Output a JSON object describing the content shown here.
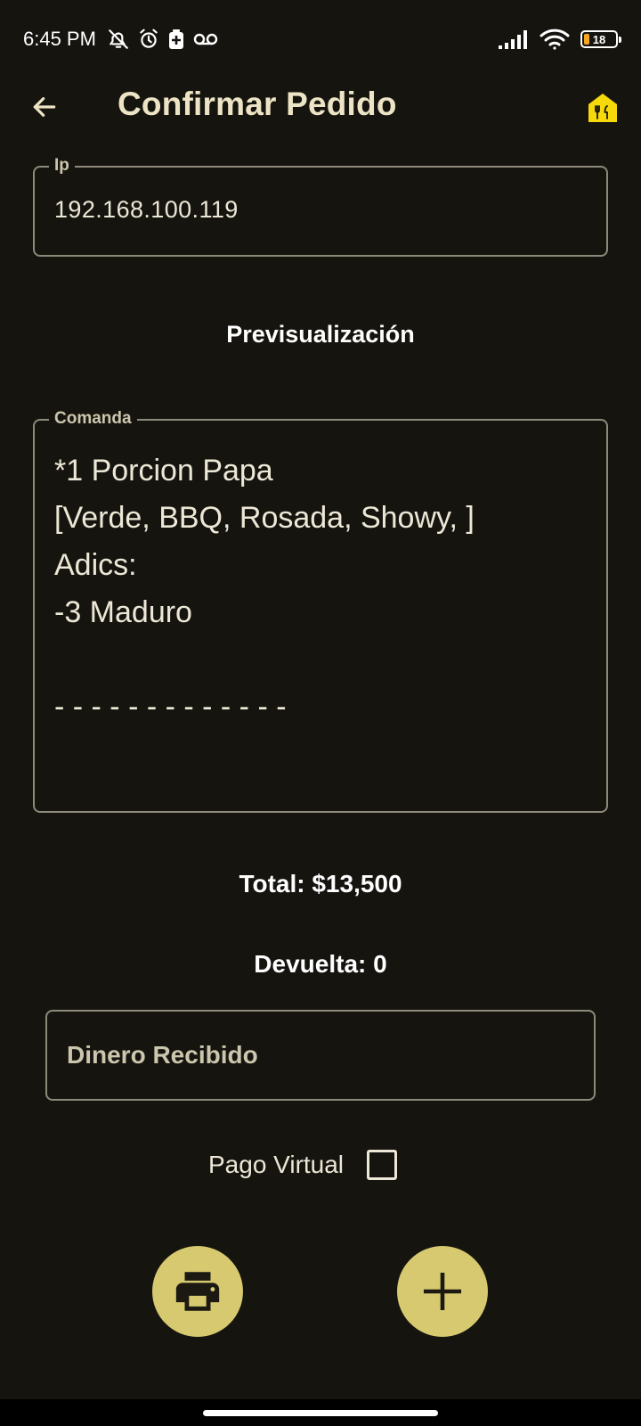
{
  "status_bar": {
    "time": "6:45 PM",
    "battery_level": "18",
    "icons": [
      "bell-off-icon",
      "alarm-icon",
      "battery-saver-icon",
      "voicemail-icon",
      "signal-icon",
      "wifi-icon",
      "battery-icon"
    ]
  },
  "app_bar": {
    "title": "Confirmar Pedido",
    "icons": [
      "back-arrow-icon",
      "restaurant-logo-icon"
    ]
  },
  "ip_field": {
    "label": "Ip",
    "value": "192.168.100.119"
  },
  "preview": {
    "title": "Previsualización"
  },
  "comanda_field": {
    "label": "Comanda",
    "text": "*1 Porcion Papa\n[Verde, BBQ, Rosada, Showy, ]\nAdics:\n-3 Maduro\n\n- - - - - - - - - - - - -"
  },
  "totals": {
    "total": "Total: $13,500",
    "change": "Devuelta: 0"
  },
  "money_field": {
    "placeholder": "Dinero Recibido",
    "value": ""
  },
  "virtual_payment": {
    "label": "Pago Virtual",
    "checked": false
  },
  "actions": {
    "icons": [
      "printer-icon",
      "plus-icon"
    ]
  },
  "colors": {
    "background": "#16140f",
    "accent": "#d6c96f",
    "title": "#ece4c4",
    "outline": "#8d8a7b",
    "logo": "#f5d90a"
  }
}
